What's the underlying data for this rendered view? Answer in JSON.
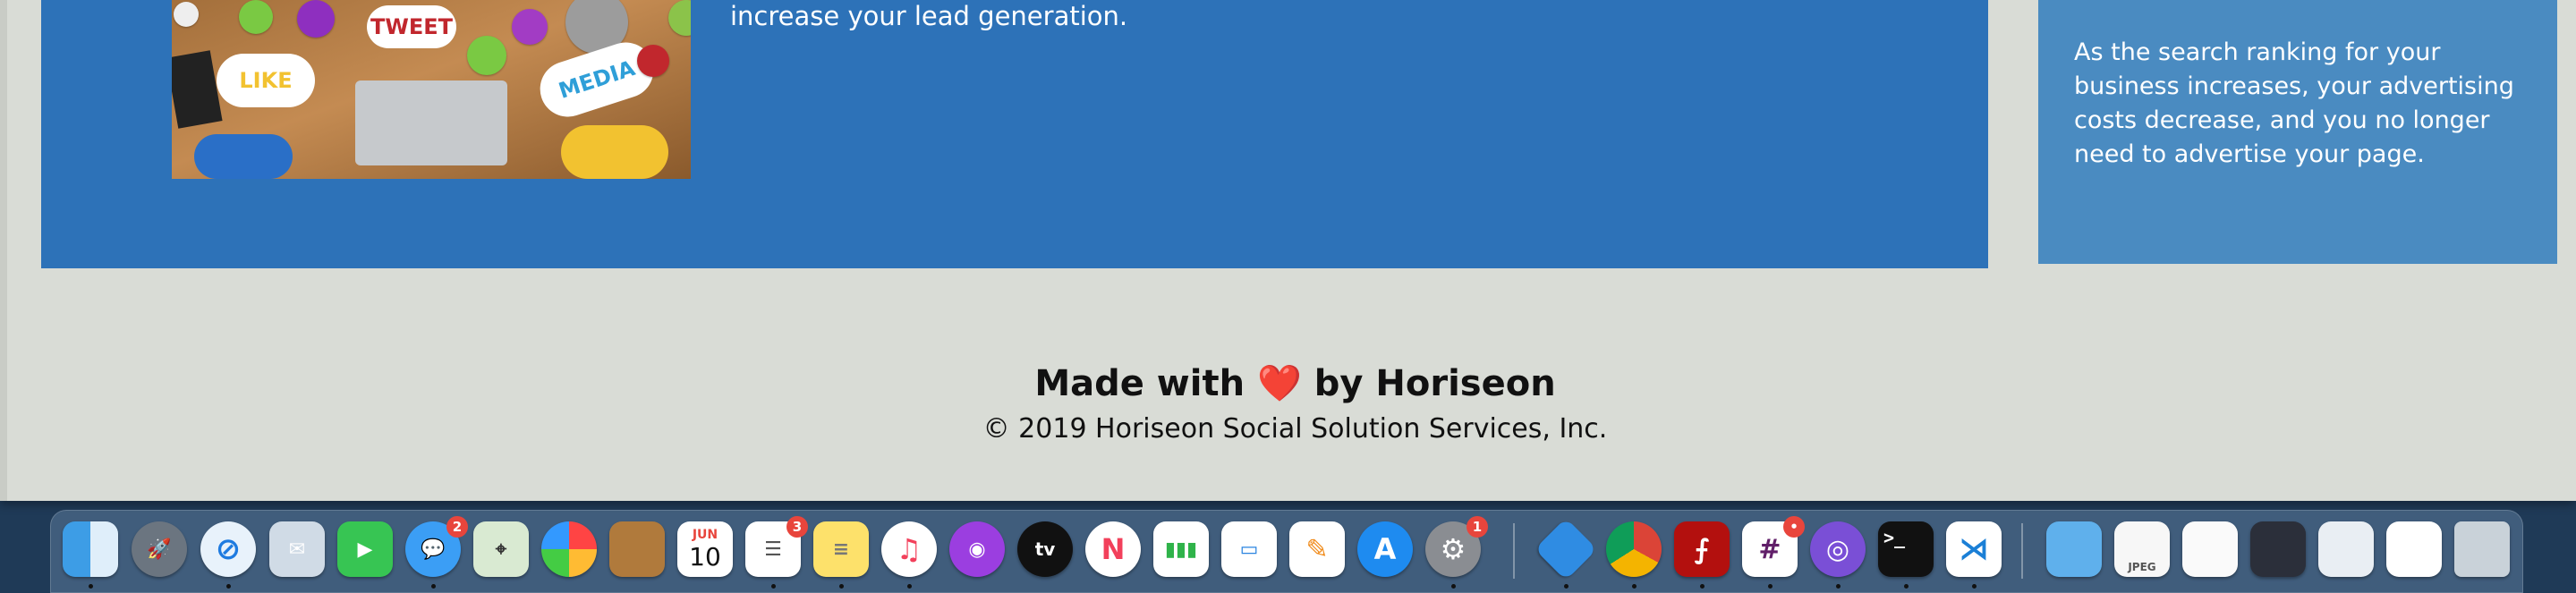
{
  "lead": {
    "text": "increase your lead generation.",
    "image_words": {
      "tweet": "TWEET",
      "like": "LIKE",
      "media": "MEDIA"
    }
  },
  "side": {
    "text": "As the search ranking for your business increases, your advertising costs decrease, and you no longer need to advertise your page."
  },
  "footer": {
    "made_with": "Made with",
    "heart": "❤️",
    "by": "by Horiseon",
    "copyright": "© 2019 Horiseon Social Solution Services, Inc."
  },
  "dock": {
    "calendar_month": "JUN",
    "calendar_day": "10",
    "messages_badge": "2",
    "reminders_badge": "3",
    "settings_badge": "1",
    "slack_badge": "•",
    "appletv_label": "tv",
    "preview_label": "JPEG"
  }
}
